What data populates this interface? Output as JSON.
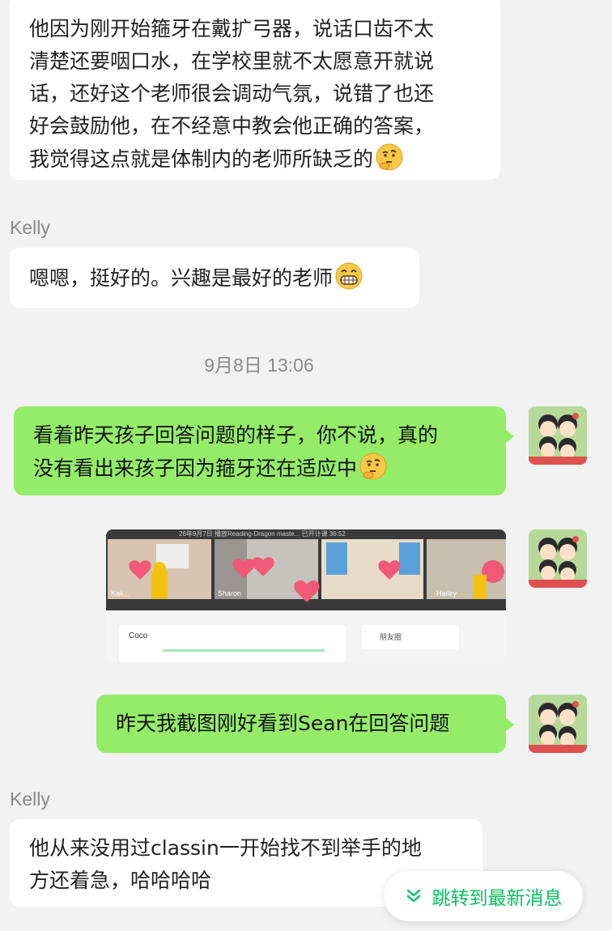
{
  "messages": {
    "m1": {
      "text_lines": [
        "他因为刚开始箍牙在戴扩弓器，说话口齿不太",
        "清楚还要咽口水，在学校里就不太愿意开就说",
        "话，还好这个老师很会调动气氛，说错了也还",
        "好会鼓励他，在不经意中教会他正确的答案，",
        "我觉得这点就是体制内的老师所缺乏的"
      ]
    },
    "m2": {
      "sender": "Kelly",
      "text": "嗯嗯，挺好的。兴趣是最好的老师"
    },
    "timestamp": "9月8日 13:06",
    "m3": {
      "text_lines": [
        "看着昨天孩子回答问题的样子，你不说，真的",
        "没有看出来孩子因为箍牙还在适应中"
      ]
    },
    "m4_image": {
      "header_text": "26年9月7日 播放Reading-Dragon maste...  已开计课 36:52",
      "tile_names": [
        "Kaii...",
        "Sharon",
        "",
        "Hailey"
      ],
      "contact_name": "Coco",
      "search_label": "朋友圈"
    },
    "m5": {
      "text": "昨天我截图刚好看到Sean在回答问题"
    },
    "m6": {
      "sender": "Kelly",
      "text_lines": [
        "他从来没用过classin一开始找不到举手的地",
        "方还着急，哈哈哈哈"
      ]
    }
  },
  "jump_button": {
    "icon": "double-chevron-down-icon",
    "label": "跳转到最新消息"
  },
  "colors": {
    "background": "#f2f2f2",
    "incoming_bubble": "#ffffff",
    "outgoing_bubble": "#95ec69",
    "accent": "#07c160"
  }
}
